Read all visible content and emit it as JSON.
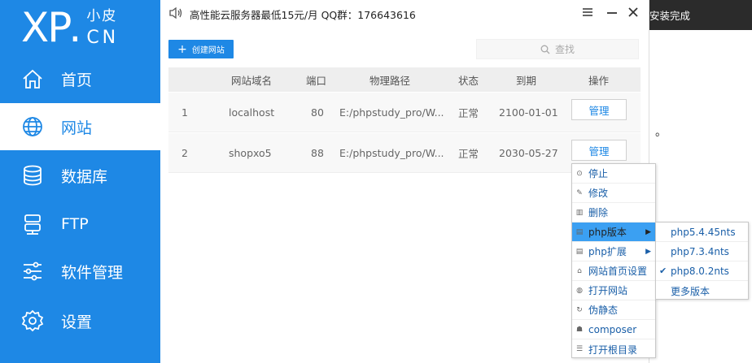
{
  "sidebar": {
    "logo": {
      "xp": "XP",
      "dot": ".",
      "top": "小皮",
      "bottom": "CN"
    },
    "items": [
      {
        "label": "首页",
        "icon": "home-icon"
      },
      {
        "label": "网站",
        "icon": "globe-icon",
        "active": true
      },
      {
        "label": "数据库",
        "icon": "database-icon"
      },
      {
        "label": "FTP",
        "icon": "server-icon"
      },
      {
        "label": "软件管理",
        "icon": "sliders-icon"
      },
      {
        "label": "设置",
        "icon": "gear-icon"
      }
    ],
    "bg_color": "#1e88e5"
  },
  "topbar": {
    "notice": "高性能云服务器最低15元/月  QQ群：176643616"
  },
  "toolbar": {
    "create_label": "创建网站",
    "search_placeholder": "查找"
  },
  "table": {
    "headers": [
      "网站域名",
      "端口",
      "物理路径",
      "状态",
      "到期",
      "操作"
    ],
    "rows": [
      {
        "index": "1",
        "domain": "localhost",
        "port": "80",
        "path": "E:/phpstudy_pro/W...",
        "status": "正常",
        "expire": "2100-01-01",
        "action": "管理"
      },
      {
        "index": "2",
        "domain": "shopxo5",
        "port": "88",
        "path": "E:/phpstudy_pro/W...",
        "status": "正常",
        "expire": "2030-05-27",
        "action": "管理"
      }
    ]
  },
  "background": {
    "bar_text": "安装完成",
    "dot": "。"
  },
  "context_menu": {
    "items": [
      {
        "label": "停止",
        "icon": "stop-icon"
      },
      {
        "label": "修改",
        "icon": "edit-icon"
      },
      {
        "label": "删除",
        "icon": "trash-icon"
      },
      {
        "label": "php版本",
        "icon": "file-icon",
        "submenu": true,
        "highlighted": true
      },
      {
        "label": "php扩展",
        "icon": "extension-icon",
        "submenu": true
      },
      {
        "label": "网站首页设置",
        "icon": "home-small-icon"
      },
      {
        "label": "打开网站",
        "icon": "browser-icon"
      },
      {
        "label": "伪静态",
        "icon": "refresh-icon"
      },
      {
        "label": "composer",
        "icon": "composer-icon"
      },
      {
        "label": "打开根目录",
        "icon": "folder-list-icon"
      }
    ],
    "submenu": [
      {
        "label": "php5.4.45nts",
        "checked": false
      },
      {
        "label": "php7.3.4nts",
        "checked": false
      },
      {
        "label": "php8.0.2nts",
        "checked": true
      },
      {
        "label": "更多版本",
        "checked": false
      }
    ],
    "highlight_color": "#3ba0f2"
  }
}
